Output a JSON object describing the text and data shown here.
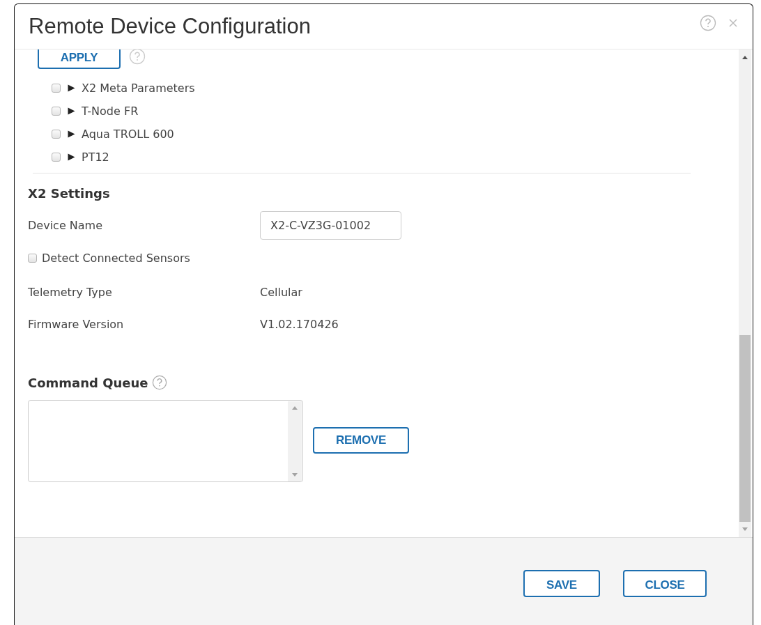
{
  "dialog": {
    "title": "Remote Device Configuration"
  },
  "apply_button": "APPLY",
  "tree": [
    {
      "label": "X2 Meta Parameters",
      "checked": false,
      "expanded": false
    },
    {
      "label": "T-Node FR",
      "checked": false,
      "expanded": false
    },
    {
      "label": "Aqua TROLL 600",
      "checked": false,
      "expanded": false
    },
    {
      "label": "PT12",
      "checked": false,
      "expanded": false
    }
  ],
  "x2_settings": {
    "heading": "X2 Settings",
    "device_name": {
      "label": "Device Name",
      "value": "X2-C-VZ3G-01002"
    },
    "detect_sensors": {
      "label": "Detect Connected Sensors",
      "checked": false
    },
    "fields": [
      {
        "label": "Telemetry Type",
        "value": "Cellular"
      },
      {
        "label": "Firmware Version",
        "value": "V1.02.170426"
      }
    ]
  },
  "command_queue": {
    "heading": "Command Queue",
    "remove_button": "REMOVE"
  },
  "footer": {
    "buttons": [
      "SAVE",
      "CLOSE"
    ]
  }
}
